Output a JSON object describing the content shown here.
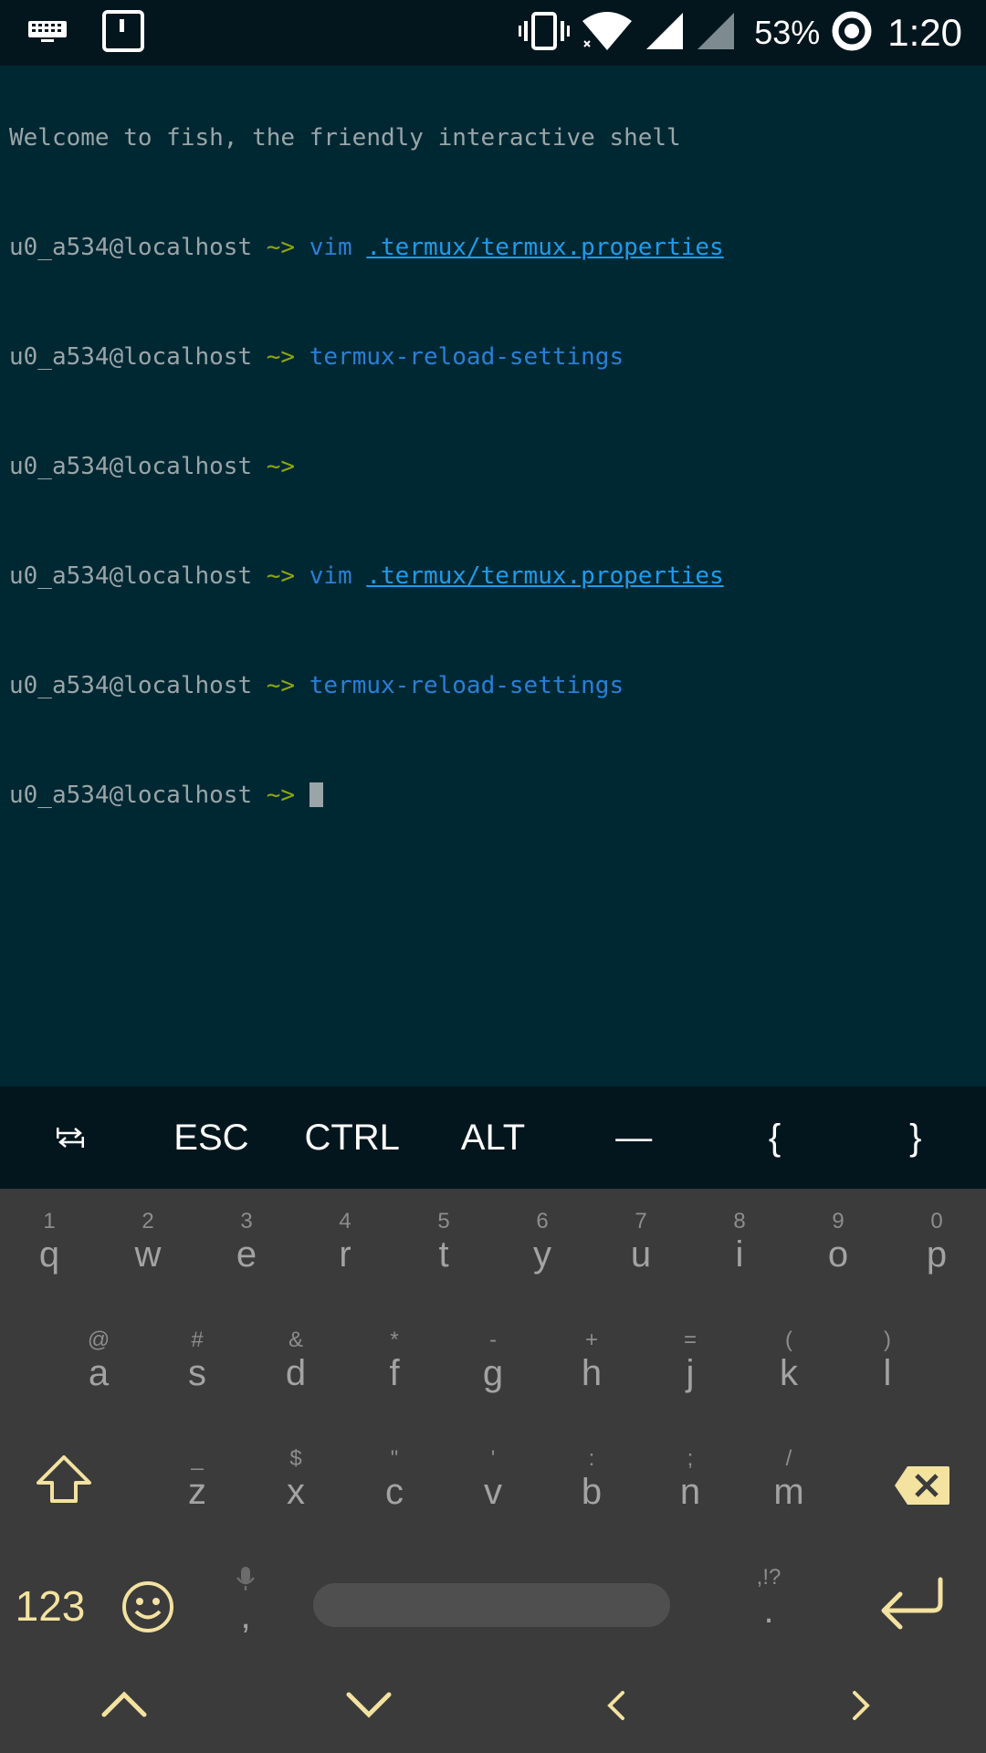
{
  "status_bar": {
    "battery_percent": "53%",
    "time": "1:20",
    "icons": [
      "keyboard-icon",
      "notification-icon",
      "vibrate-icon",
      "wifi-icon",
      "signal-icon",
      "signal-empty-icon",
      "battery-saver-icon"
    ]
  },
  "terminal": {
    "welcome": "Welcome to fish, the friendly interactive shell",
    "prompt_user": "u0_a534@localhost",
    "prompt_symbol": "~>",
    "lines": [
      {
        "cmd": "vim",
        "arg": ".termux/termux.properties"
      },
      {
        "cmd": "termux-reload-settings",
        "arg": ""
      },
      {
        "cmd": "",
        "arg": ""
      },
      {
        "cmd": "vim",
        "arg": ".termux/termux.properties"
      },
      {
        "cmd": "termux-reload-settings",
        "arg": ""
      }
    ]
  },
  "extra_keys": {
    "tab_icon": "tab-icon",
    "esc": "ESC",
    "ctrl": "CTRL",
    "alt": "ALT",
    "dash": "—",
    "lbrace": "{",
    "rbrace": "}"
  },
  "keyboard": {
    "row1": [
      {
        "main": "q",
        "alt": "1"
      },
      {
        "main": "w",
        "alt": "2"
      },
      {
        "main": "e",
        "alt": "3"
      },
      {
        "main": "r",
        "alt": "4"
      },
      {
        "main": "t",
        "alt": "5"
      },
      {
        "main": "y",
        "alt": "6"
      },
      {
        "main": "u",
        "alt": "7"
      },
      {
        "main": "i",
        "alt": "8"
      },
      {
        "main": "o",
        "alt": "9"
      },
      {
        "main": "p",
        "alt": "0"
      }
    ],
    "row2": [
      {
        "main": "a",
        "alt": "@"
      },
      {
        "main": "s",
        "alt": "#"
      },
      {
        "main": "d",
        "alt": "&"
      },
      {
        "main": "f",
        "alt": "*"
      },
      {
        "main": "g",
        "alt": "-"
      },
      {
        "main": "h",
        "alt": "+"
      },
      {
        "main": "j",
        "alt": "="
      },
      {
        "main": "k",
        "alt": "("
      },
      {
        "main": "l",
        "alt": ")"
      }
    ],
    "row3": [
      {
        "main": "z",
        "alt": "_"
      },
      {
        "main": "x",
        "alt": "$"
      },
      {
        "main": "c",
        "alt": "\""
      },
      {
        "main": "v",
        "alt": "'"
      },
      {
        "main": "b",
        "alt": ":"
      },
      {
        "main": "n",
        "alt": ";"
      },
      {
        "main": "m",
        "alt": "/"
      }
    ],
    "numbers_key": "123",
    "comma": ",",
    "period": ".",
    "period_alt": ",!?",
    "accent_color": "#f3e2a0"
  }
}
